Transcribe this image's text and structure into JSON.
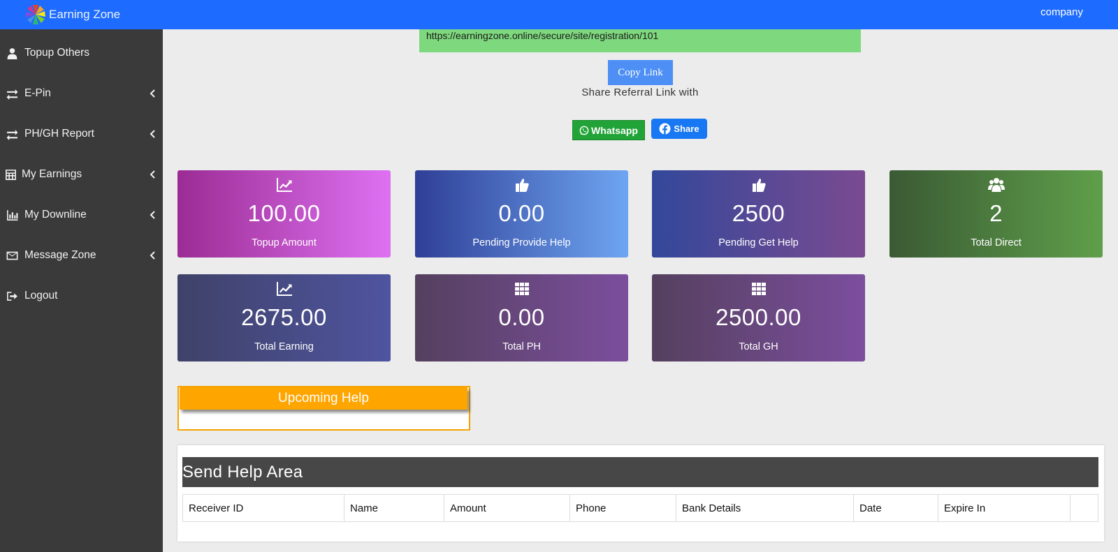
{
  "header": {
    "brand": "Earning Zone",
    "user": "company"
  },
  "sidebar": {
    "items": [
      {
        "label": "Topup Others",
        "icon": "user-icon",
        "submenu": false
      },
      {
        "label": "E-Pin",
        "icon": "exchange-icon",
        "submenu": true
      },
      {
        "label": "PH/GH Report",
        "icon": "exchange-icon",
        "submenu": true
      },
      {
        "label": "My Earnings",
        "icon": "calculator-icon",
        "submenu": true
      },
      {
        "label": "My Downline",
        "icon": "bar-chart-icon",
        "submenu": true
      },
      {
        "label": "Message Zone",
        "icon": "envelope-icon",
        "submenu": true
      },
      {
        "label": "Logout",
        "icon": "sign-out-icon",
        "submenu": false
      }
    ]
  },
  "referral": {
    "link": "https://earningzone.online/secure/site/registration/101",
    "copy_label": "Copy Link",
    "share_text": "Share Referral Link with",
    "whatsapp_label": "Whatsapp",
    "facebook_label": "Share"
  },
  "stats": [
    {
      "value": "100.00",
      "label": "Topup Amount",
      "icon": "line-chart-icon"
    },
    {
      "value": "0.00",
      "label": "Pending Provide Help",
      "icon": "thumbs-up-icon"
    },
    {
      "value": "2500",
      "label": "Pending Get Help",
      "icon": "thumbs-up-icon"
    },
    {
      "value": "2",
      "label": "Total Direct",
      "icon": "users-icon"
    },
    {
      "value": "2675.00",
      "label": "Total Earning",
      "icon": "line-chart-icon"
    },
    {
      "value": "0.00",
      "label": "Total PH",
      "icon": "grid-icon"
    },
    {
      "value": "2500.00",
      "label": "Total GH",
      "icon": "grid-icon"
    }
  ],
  "upcoming": {
    "title": "Upcoming Help"
  },
  "send_help": {
    "title": "Send Help Area",
    "columns": [
      "Receiver ID",
      "Name",
      "Amount",
      "Phone",
      "Bank Details",
      "Date",
      "Expire In",
      ""
    ]
  },
  "colors": {
    "topbar": "#1e6bff",
    "sidebar": "#3a3a3a",
    "referral_bg": "#7ed87e",
    "upcoming_accent": "#ffa500"
  }
}
